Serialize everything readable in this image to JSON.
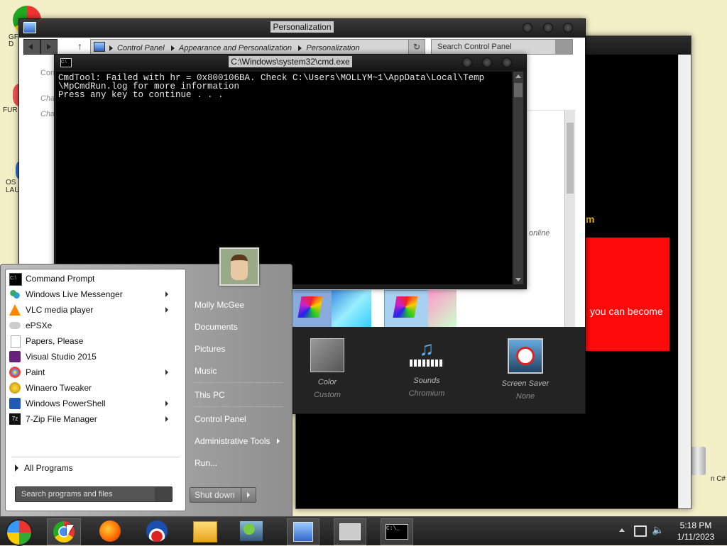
{
  "desktop": {
    "icons": [
      {
        "label": "GF\nD",
        "icon": "chrome-icon"
      },
      {
        "label": "FUR",
        "icon": "app-icon"
      },
      {
        "label": "OS\nLAU",
        "icon": "app-icon"
      },
      {
        "label": "n C#",
        "icon": "recycle-bin-icon"
      }
    ]
  },
  "personalization_window": {
    "title": "Personalization",
    "breadcrumb": [
      "Control Panel",
      "Appearance and Personalization",
      "Personalization"
    ],
    "search_placeholder": "Search Control Panel",
    "left_links": [
      "Con",
      "Cha",
      "Cha"
    ],
    "online_text": "online",
    "bottom_items": [
      {
        "label": "Color",
        "value": "Custom",
        "icon": "color-swatch-icon"
      },
      {
        "label": "Sounds",
        "value": "Chromium",
        "icon": "sounds-icon"
      },
      {
        "label": "Screen Saver",
        "value": "None",
        "icon": "screen-saver-icon"
      }
    ]
  },
  "browser_window": {
    "heading_fragment": "m",
    "banner_text": "you can become",
    "banner_color": "#ff0a0a"
  },
  "cmd_window": {
    "title": "C:\\Windows\\system32\\cmd.exe",
    "lines": [
      "CmdTool: Failed with hr = 0x800106BA. Check C:\\Users\\MOLLYM~1\\AppData\\Local\\Temp",
      "\\MpCmdRun.log for more information",
      "Press any key to continue . . ."
    ]
  },
  "start_menu": {
    "programs": [
      {
        "label": "Command Prompt",
        "icon": "cmd-icon",
        "submenu": false
      },
      {
        "label": "Windows Live Messenger",
        "icon": "messenger-icon",
        "submenu": true
      },
      {
        "label": "VLC media player",
        "icon": "vlc-icon",
        "submenu": true
      },
      {
        "label": "ePSXe",
        "icon": "gamepad-icon",
        "submenu": false
      },
      {
        "label": "Papers, Please",
        "icon": "document-icon",
        "submenu": false
      },
      {
        "label": "Visual Studio 2015",
        "icon": "visual-studio-icon",
        "submenu": false
      },
      {
        "label": "Paint",
        "icon": "paint-icon",
        "submenu": true
      },
      {
        "label": "Winaero Tweaker",
        "icon": "tweaker-icon",
        "submenu": false
      },
      {
        "label": "Windows PowerShell",
        "icon": "powershell-icon",
        "submenu": true
      },
      {
        "label": "7-Zip File Manager",
        "icon": "7zip-icon",
        "submenu": true
      }
    ],
    "all_programs": "All Programs",
    "search_placeholder": "Search programs and files",
    "right_items": [
      "Molly McGee",
      "Documents",
      "Pictures",
      "Music",
      "This PC",
      "Control Panel",
      "Administrative Tools",
      "Run..."
    ],
    "shutdown_label": "Shut down"
  },
  "taskbar": {
    "pinned": [
      "start-orb-icon",
      "chrome-icon",
      "firefox-icon",
      "obama-icon",
      "file-explorer-icon",
      "network-icon",
      "control-panel-icon",
      "cmd-icon",
      "terminal-icon"
    ],
    "clock_time": "5:18 PM",
    "clock_date": "1/11/2023"
  }
}
